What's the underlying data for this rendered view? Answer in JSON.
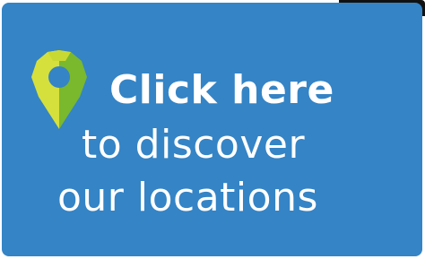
{
  "cta": {
    "headline": "Click here",
    "line1": "to discover",
    "line2": "our locations"
  },
  "colors": {
    "background": "#3484c6",
    "text": "#ffffff",
    "pin_light": "#d5e03c",
    "pin_dark": "#7ab82e"
  },
  "icon": {
    "name": "location-pin-icon"
  }
}
